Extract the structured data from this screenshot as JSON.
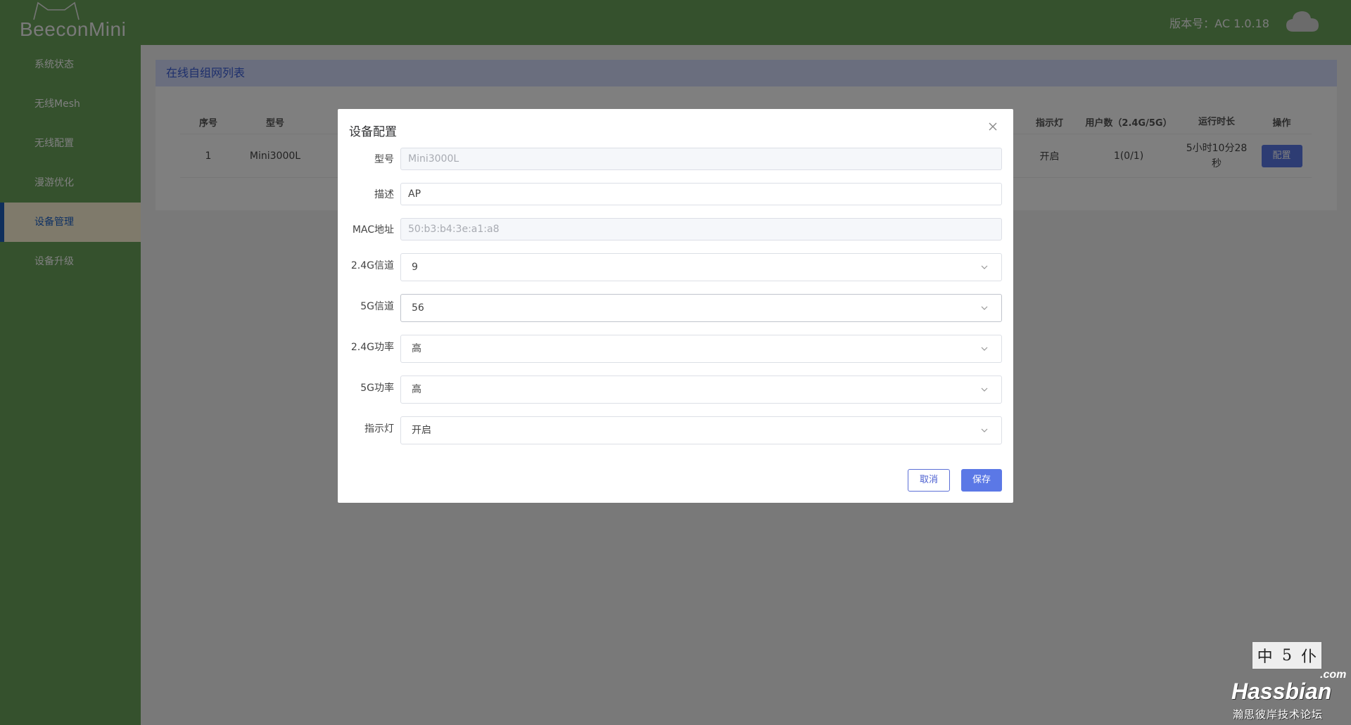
{
  "app": {
    "brand": "BeeconMini",
    "version_text": "版本号：AC 1.0.18"
  },
  "sidebar": {
    "items": [
      {
        "label": "系统状态"
      },
      {
        "label": "无线Mesh"
      },
      {
        "label": "无线配置"
      },
      {
        "label": "漫游优化"
      },
      {
        "label": "设备管理",
        "active": true
      },
      {
        "label": "设备升级"
      }
    ]
  },
  "panel": {
    "title": "在线自组网列表",
    "columns": {
      "seq": "序号",
      "model": "型号",
      "led": "指示灯",
      "users": "用户数（2.4G/5G）",
      "uptime": "运行时长",
      "op": "操作"
    },
    "rows": [
      {
        "seq": "1",
        "model": "Mini3000L",
        "led": "开启",
        "users": "1(0/1)",
        "uptime_line1": "5小时10分28",
        "uptime_line2": "秒",
        "op": "配置"
      }
    ]
  },
  "dialog": {
    "title": "设备配置",
    "fields": {
      "model": {
        "label": "型号",
        "value": "Mini3000L"
      },
      "description": {
        "label": "描述",
        "value": "AP"
      },
      "mac": {
        "label": "MAC地址",
        "value": "50:b3:b4:3e:a1:a8"
      },
      "channel_24g": {
        "label": "2.4G信道",
        "value": "9"
      },
      "channel_5g": {
        "label": "5G信道",
        "value": "56"
      },
      "power_24g": {
        "label": "2.4G功率",
        "value": "高"
      },
      "power_5g": {
        "label": "5G功率",
        "value": "高"
      },
      "led": {
        "label": "指示灯",
        "value": "开启"
      }
    },
    "cancel_label": "取消",
    "save_label": "保存"
  },
  "watermark": {
    "seal": [
      "中",
      "5",
      "仆"
    ],
    "com": ".com",
    "name": "Hassbian",
    "subtitle": "瀚思彼岸技术论坛"
  },
  "colors": {
    "sidebar_green": "#6aa35a",
    "accent_blue": "#5b78e6",
    "active_nav_bg": "#fff4d6",
    "panel_header_bg": "#d4dcfd"
  }
}
